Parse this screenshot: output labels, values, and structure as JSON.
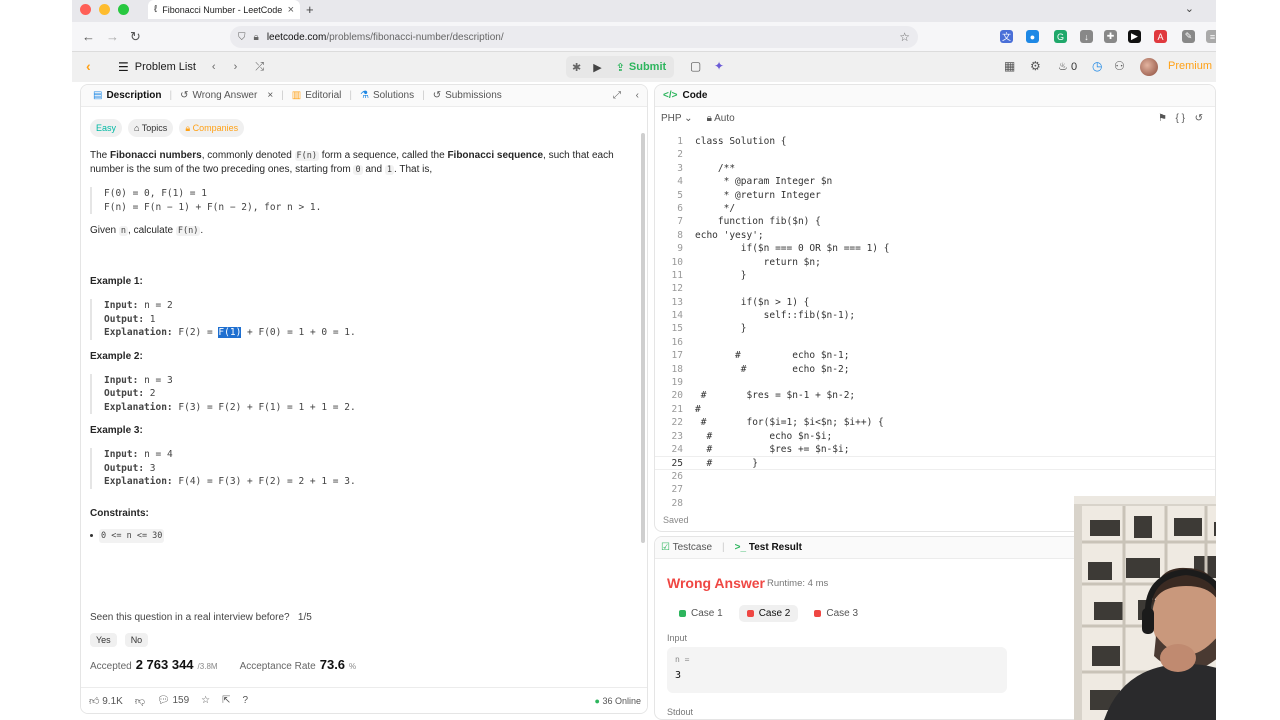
{
  "browser": {
    "tab_title": "Fibonacci Number - LeetCode",
    "url_host": "leetcode.com",
    "url_path": "/problems/fibonacci-number/description/"
  },
  "header": {
    "problem_list": "Problem List",
    "submit": "Submit",
    "fire_count": "0",
    "premium": "Premium"
  },
  "left_tabs": {
    "description": "Description",
    "wrong_answer": "Wrong Answer",
    "editorial": "Editorial",
    "solutions": "Solutions",
    "submissions": "Submissions"
  },
  "tags": {
    "difficulty": "Easy",
    "topics": "Topics",
    "companies": "Companies"
  },
  "problem": {
    "p1_a": "The ",
    "p1_b": "Fibonacci numbers",
    "p1_c": ", commonly denoted ",
    "p1_code1": "F(n)",
    "p1_d": " form a sequence, called the ",
    "p1_e": "Fibonacci sequence",
    "p1_f": ", such that each number is the sum of the two preceding ones, starting from ",
    "p1_code2": "0",
    "p1_g": " and ",
    "p1_code3": "1",
    "p1_h": ". That is,",
    "formula1": "F(0) = 0, F(1) = 1",
    "formula2": "F(n) = F(n − 1) + F(n − 2), for n > 1.",
    "given_a": "Given ",
    "given_code1": "n",
    "given_b": ", calculate ",
    "given_code2": "F(n)",
    "given_c": "."
  },
  "examples": [
    {
      "title": "Example 1:",
      "input": "n = 2",
      "output": "1",
      "expl_pre": "F(2) = ",
      "expl_hl": "F(1)",
      "expl_post": " + F(0) = 1 + 0 = 1."
    },
    {
      "title": "Example 2:",
      "input": "n = 3",
      "output": "2",
      "expl_pre": "F(3) = F(2) + F(1) = 1 + 1 = 2.",
      "expl_hl": "",
      "expl_post": ""
    },
    {
      "title": "Example 3:",
      "input": "n = 4",
      "output": "3",
      "expl_pre": "F(4) = F(3) + F(2) = 2 + 1 = 3.",
      "expl_hl": "",
      "expl_post": ""
    }
  ],
  "labels": {
    "input": "Input:",
    "output": "Output:",
    "explanation": "Explanation:"
  },
  "constraints": {
    "title": "Constraints:",
    "item": "0 <= n <= 30"
  },
  "interview": {
    "question": "Seen this question in a real interview before?",
    "ratio": "1/5",
    "yes": "Yes",
    "no": "No"
  },
  "stats": {
    "accepted_label": "Accepted",
    "accepted_value": "2 763 344",
    "accepted_total": "/3.8M",
    "rate_label": "Acceptance Rate",
    "rate_value": "73.6",
    "rate_unit": "%"
  },
  "footer": {
    "likes": "9.1K",
    "comments": "159",
    "online": "36 Online"
  },
  "code_panel": {
    "title": "Code",
    "language": "PHP",
    "mode": "Auto",
    "saved": "Saved"
  },
  "code_lines": [
    "class Solution {",
    "",
    "    /**",
    "     * @param Integer $n",
    "     * @return Integer",
    "     */",
    "    function fib($n) {",
    "echo 'yesy';",
    "        if($n === 0 OR $n === 1) {",
    "            return $n;",
    "        }",
    "",
    "        if($n > 1) {",
    "            self::fib($n-1);",
    "        }",
    "",
    "       #         echo $n-1;",
    "        #        echo $n-2;",
    "",
    " #       $res = $n-1 + $n-2;",
    "#",
    " #       for($i=1; $i<$n; $i++) {",
    "  #          echo $n-$i;",
    "  #          $res += $n-$i;",
    "  #       }",
    "",
    "",
    ""
  ],
  "test": {
    "testcase_tab": "Testcase",
    "result_tab": "Test Result",
    "verdict": "Wrong Answer",
    "runtime": "Runtime: 4 ms",
    "cases": [
      "Case 1",
      "Case 2",
      "Case 3"
    ],
    "input_label": "Input",
    "input_var": "n =",
    "input_val": "3",
    "stdout_label": "Stdout"
  },
  "colors": {
    "accent": "#ffa116",
    "submit_green": "#2db55d",
    "wrong_red": "#ef4743",
    "easy_teal": "#00b8a3"
  }
}
